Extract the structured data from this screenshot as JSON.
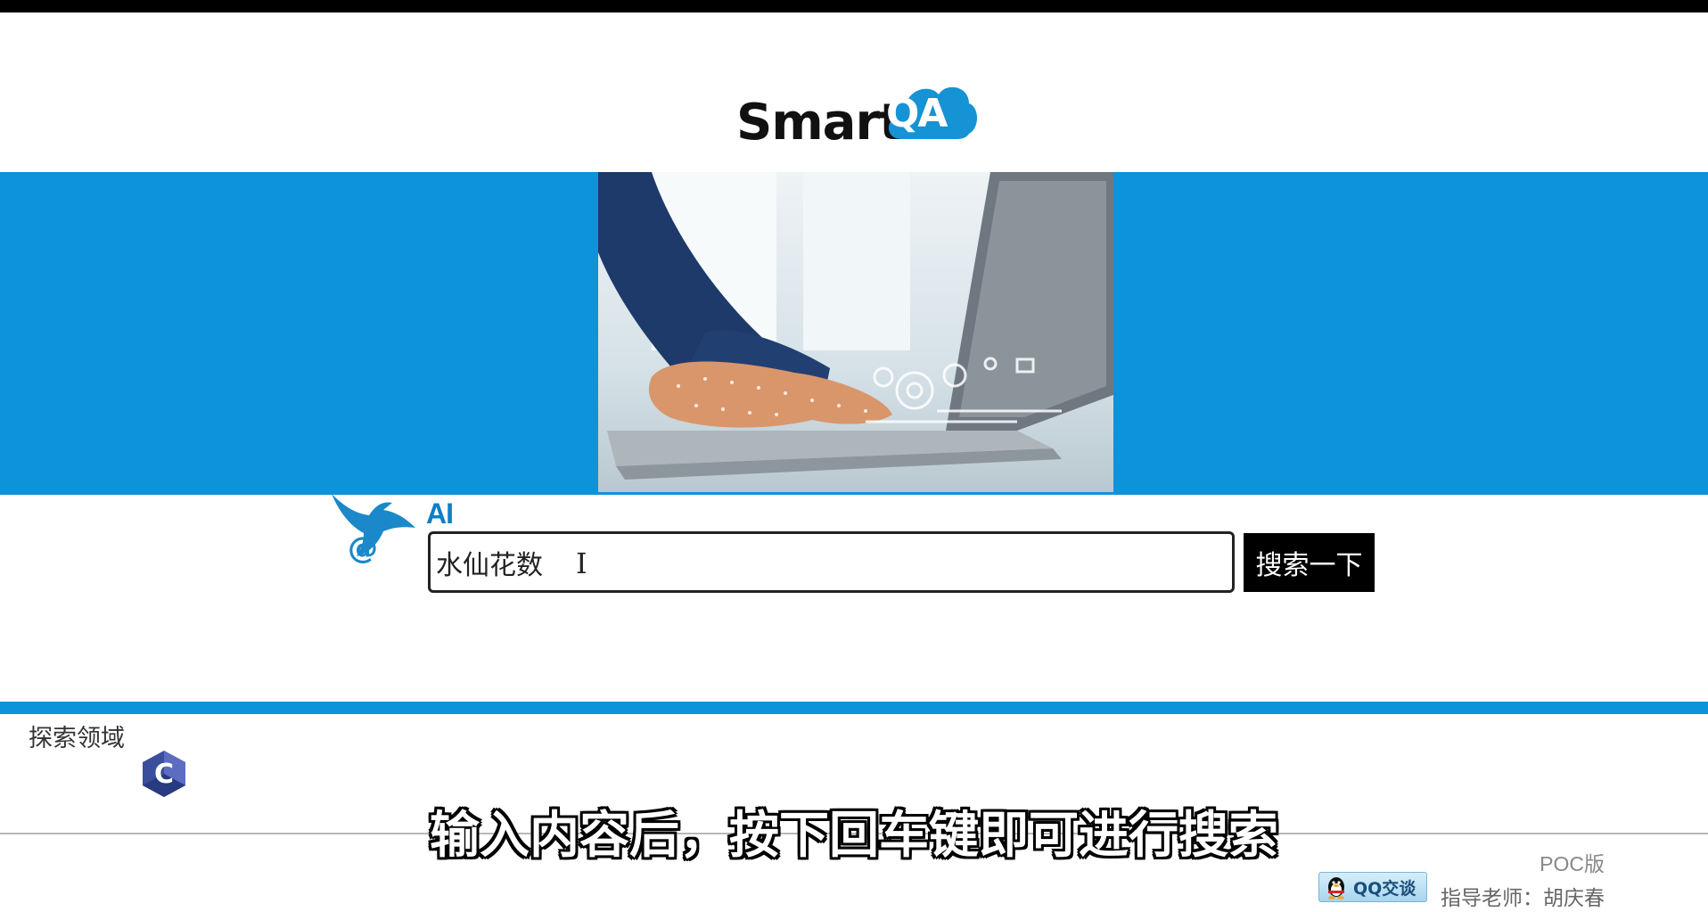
{
  "header": {
    "logo_text": "Smart",
    "logo_badge": "QA",
    "brand_color": "#0c93d9"
  },
  "search": {
    "ai_label": "AI",
    "query_value": "水仙花数",
    "cursor_glyph": "I",
    "button_label": "搜索一下"
  },
  "explore": {
    "title": "探索领域",
    "items": [
      {
        "icon": "c-language-icon",
        "letter": "C"
      }
    ]
  },
  "subtitle": "输入内容后，按下回车键即可进行搜索",
  "footer": {
    "version": "POC版",
    "qq_button_label": "QQ交谈",
    "teacher": "指导老师：胡庆春"
  }
}
